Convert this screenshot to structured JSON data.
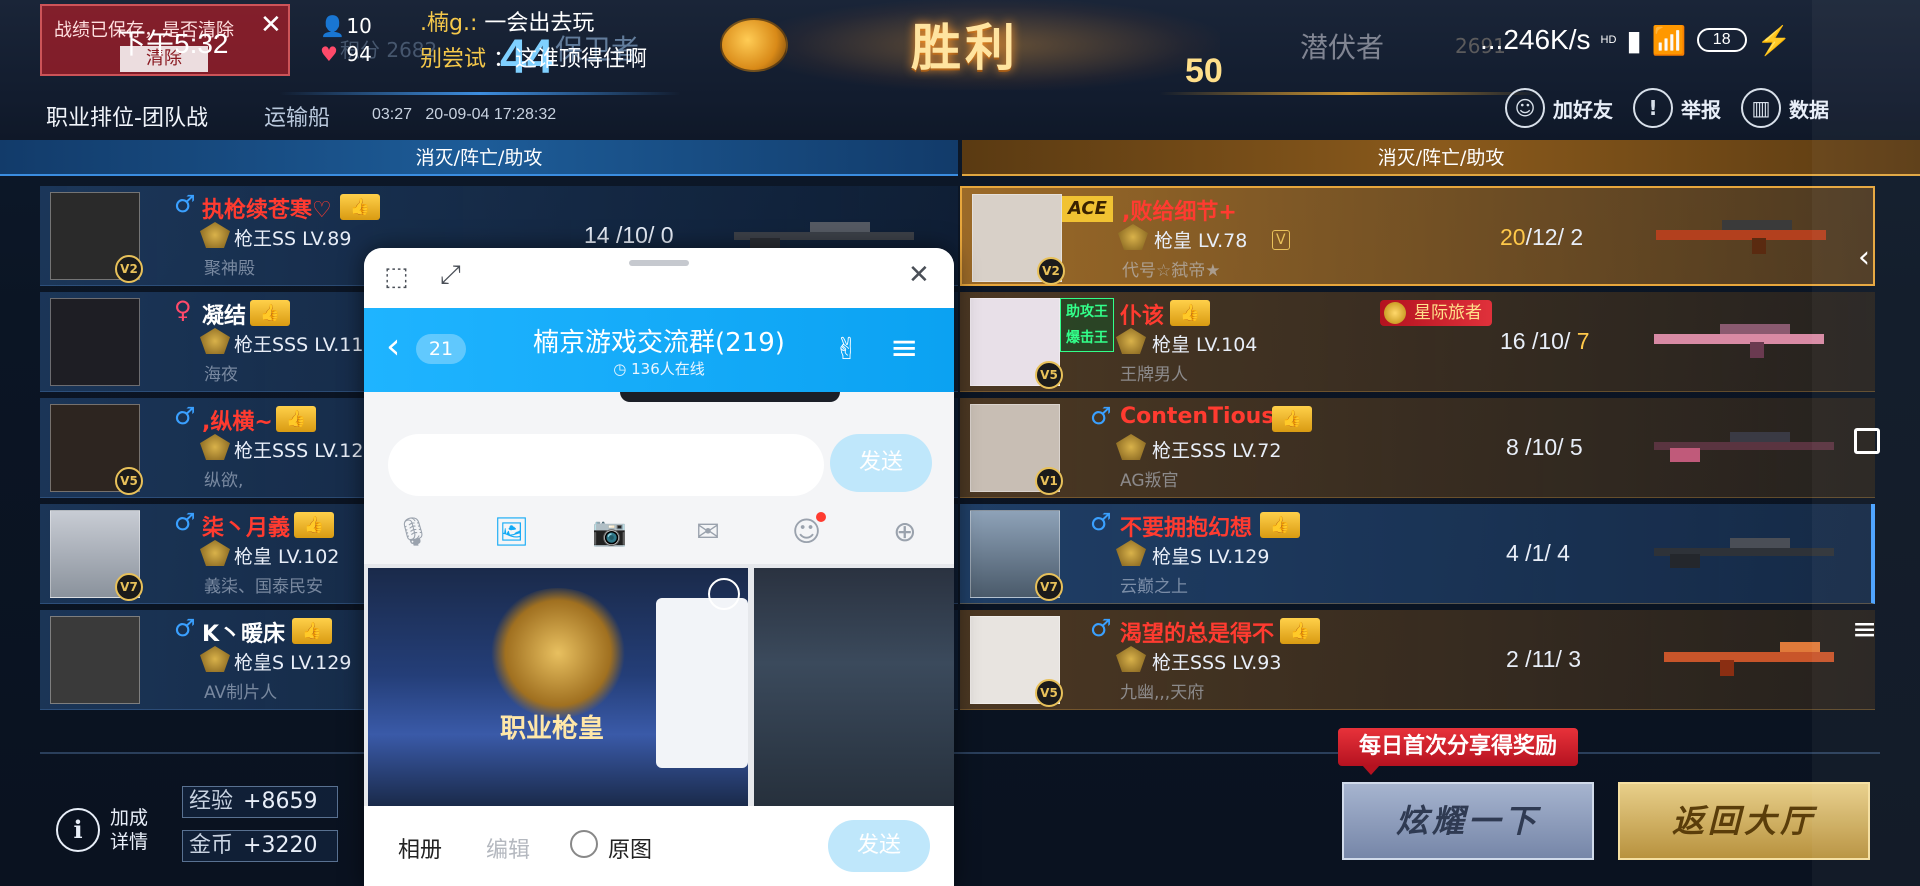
{
  "status_bar": {
    "time": "下午5:32",
    "network_speed": "...246K/s",
    "hd": "HD",
    "battery": "18"
  },
  "notice": {
    "text": "战绩已保存，是否清除",
    "clear_label": "清除"
  },
  "counts": {
    "players": "10",
    "likes": "94"
  },
  "chat": {
    "line1_name": ".楠g.:",
    "line1_msg": "一会出去玩",
    "line2_name": "别尝试",
    "line2_msg": "：这谁顶得住啊"
  },
  "scoreboard": {
    "result": "胜利",
    "left_team": "保卫者",
    "left_score": "44",
    "left_faint": "积分 2682",
    "right_team": "潜伏者",
    "right_score": "50",
    "right_faint": "2691"
  },
  "match": {
    "mode": "职业排位-团队战",
    "map": "运输船",
    "duration": "03:27",
    "datetime": "20-09-04 17:28:32"
  },
  "top_actions": [
    {
      "label": "加好友",
      "icon": "add-friend-icon"
    },
    {
      "label": "举报",
      "icon": "report-icon"
    },
    {
      "label": "数据",
      "icon": "stats-icon"
    }
  ],
  "column_header": "消灭/阵亡/助攻",
  "left_players": [
    {
      "name": "执枪续苍寒♡",
      "gender": "♂",
      "rank": "枪王SS LV.89",
      "guild": "聚神殿",
      "kda": "14 /10/ 0",
      "badge": "V2",
      "avatar_color": "#2a2a2a"
    },
    {
      "name": "凝结",
      "gender": "♀",
      "rank": "枪王SSS LV.11",
      "guild": "海夜",
      "kda": "",
      "badge": "",
      "avatar_color": "#1e1e24"
    },
    {
      "name": ",纵横~",
      "gender": "♂",
      "rank": "枪王SSS LV.12",
      "guild": "纵欲,",
      "kda": "",
      "badge": "V5",
      "avatar_color": "#2d2520"
    },
    {
      "name": "柒丶月義",
      "gender": "♂",
      "rank": "枪皇 LV.102",
      "guild": "義柒、国泰民安",
      "kda": "",
      "badge": "V7",
      "avatar_color": "#c8ccd4"
    },
    {
      "name": "K丶暖床",
      "gender": "♂",
      "rank": "枪皇S LV.129",
      "guild": "AV制片人",
      "kda": "",
      "badge": "",
      "avatar_color": "#3a3a3a"
    }
  ],
  "right_players": [
    {
      "name": ",败给细节+",
      "tag": "ACE",
      "rank": "枪皇 LV.78",
      "guild": "代号☆弑帝★",
      "kda_k": "20",
      "kda_rest": "/12/ 2",
      "badge": "V2",
      "avatar_color": "#d8d0c8"
    },
    {
      "name": "仆该",
      "tag": "助攻王 爆击王",
      "title_badge": "星际旅者",
      "rank": "枪皇 LV.104",
      "guild": "王牌男人",
      "kda_k": "16 /10/ ",
      "kda_rest": "7",
      "badge": "V5",
      "avatar_color": "#e8e0e8"
    },
    {
      "name": "ContenTious",
      "gender": "♂",
      "rank": "枪王SSS LV.72",
      "guild": "AG叛官",
      "kda_k": "8 /10/ 5",
      "kda_rest": "",
      "badge": "V1",
      "avatar_color": "#c8beb4"
    },
    {
      "name": "不要拥抱幻想",
      "gender": "♂",
      "rank": "枪皇S LV.129",
      "guild": "云巅之上",
      "kda_k": "4 /1/ 4",
      "kda_rest": "",
      "badge": "V7",
      "avatar_color": "#6a7a8a"
    },
    {
      "name": "渴望的总是得不",
      "gender": "♂",
      "rank": "枪王SSS LV.93",
      "guild": "九幽,,,天府",
      "kda_k": "2 /11/ 3",
      "kda_rest": "",
      "badge": "V5",
      "avatar_color": "#e8e4e0"
    }
  ],
  "bonus": {
    "label_line1": "加成",
    "label_line2": "详情",
    "exp_label": "经验",
    "exp_value": "+8659",
    "coin_label": "金币",
    "coin_value": "+3220"
  },
  "share_tip": "每日首次分享得奖励",
  "buttons": {
    "share": "炫耀一下",
    "lobby": "返回大厅"
  },
  "qq": {
    "back_count": "21",
    "group_name": "楠京游戏交流群(219)",
    "online": "136人在线",
    "send_top": "发送",
    "album": "相册",
    "edit": "编辑",
    "original": "原图",
    "send_bottom": "发送",
    "thumb_text": "职业枪皇",
    "colors": {
      "header": "#12aaf5",
      "send_disabled": "#bfe7fb"
    }
  }
}
